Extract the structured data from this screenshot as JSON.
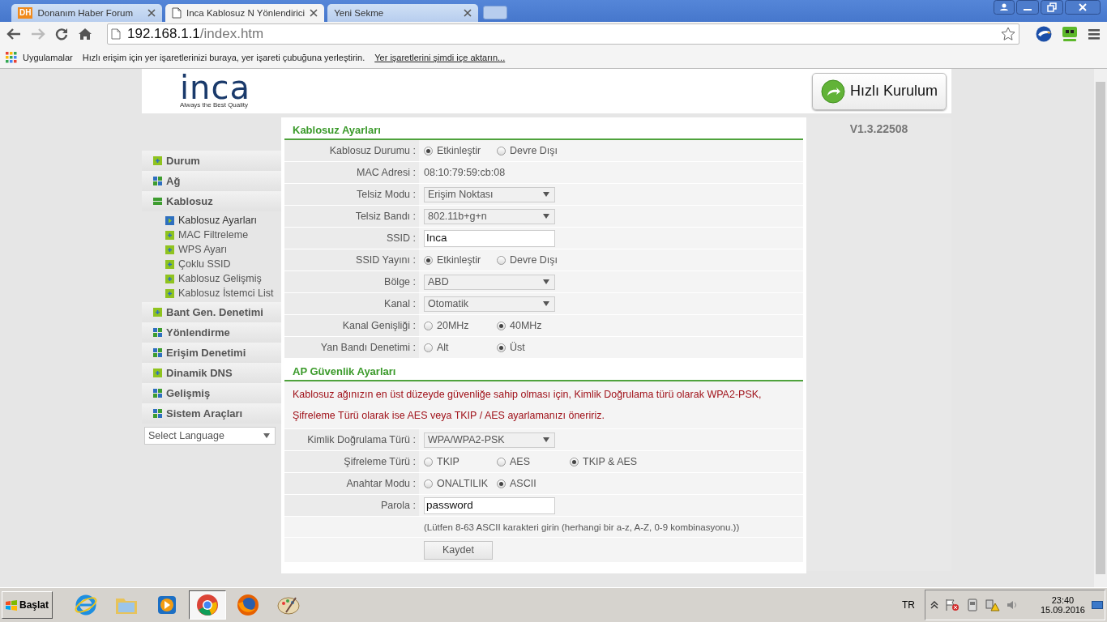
{
  "browser": {
    "tabs": [
      {
        "title": "Donanım Haber Forum",
        "selected": false,
        "kind": "badge",
        "badge": "DH"
      },
      {
        "title": "Inca Kablosuz N Yönlendirici",
        "selected": true,
        "kind": "page"
      },
      {
        "title": "Yeni Sekme",
        "selected": false,
        "kind": "blank"
      }
    ],
    "address": {
      "host": "192.168.1.1",
      "path": "/index.htm"
    },
    "bookmarks": {
      "apps_label": "Uygulamalar",
      "hint": "Hızlı erişim için yer işaretlerinizi buraya, yer işareti çubuğuna yerleştirin.",
      "import_link": "Yer işaretlerini şimdi içe aktarın..."
    }
  },
  "header": {
    "logo": "inca",
    "tagline": "Always the Best Quality",
    "quick_setup": "Hızlı Kurulum",
    "version": "V1.3.22508"
  },
  "sidebar": {
    "items": [
      {
        "label": "Durum",
        "kind": "page"
      },
      {
        "label": "Ağ",
        "kind": "group",
        "expanded": false
      },
      {
        "label": "Kablosuz",
        "kind": "group",
        "expanded": true,
        "children": [
          {
            "label": "Kablosuz Ayarları",
            "selected": true
          },
          {
            "label": "MAC Filtreleme",
            "selected": false
          },
          {
            "label": "WPS Ayarı",
            "selected": false
          },
          {
            "label": "Çoklu SSID",
            "selected": false
          },
          {
            "label": "Kablosuz Gelişmiş",
            "selected": false
          },
          {
            "label": "Kablosuz İstemci List",
            "selected": false
          }
        ]
      },
      {
        "label": "Bant Gen. Denetimi",
        "kind": "page"
      },
      {
        "label": "Yönlendirme",
        "kind": "group",
        "expanded": false
      },
      {
        "label": "Erişim Denetimi",
        "kind": "group",
        "expanded": false
      },
      {
        "label": "Dinamik DNS",
        "kind": "page"
      },
      {
        "label": "Gelişmiş",
        "kind": "group",
        "expanded": false
      },
      {
        "label": "Sistem Araçları",
        "kind": "group",
        "expanded": false
      }
    ],
    "language": "Select Language"
  },
  "sections": [
    {
      "title": "Kablosuz Ayarları",
      "rows": [
        {
          "kind": "radio",
          "label": "Kablosuz Durumu :",
          "options": [
            {
              "label": "Etkinleştir",
              "selected": true
            },
            {
              "label": "Devre Dışı",
              "selected": false
            }
          ]
        },
        {
          "kind": "text",
          "label": "MAC Adresi :",
          "value": "08:10:79:59:cb:08"
        },
        {
          "kind": "select",
          "label": "Telsiz Modu :",
          "value": "Erişim Noktası"
        },
        {
          "kind": "select",
          "label": "Telsiz Bandı :",
          "value": "802.11b+g+n"
        },
        {
          "kind": "input",
          "label": "SSID :",
          "value": "Inca"
        },
        {
          "kind": "radio",
          "label": "SSID Yayını :",
          "options": [
            {
              "label": "Etkinleştir",
              "selected": true
            },
            {
              "label": "Devre Dışı",
              "selected": false
            }
          ]
        },
        {
          "kind": "select",
          "label": "Bölge :",
          "value": "ABD"
        },
        {
          "kind": "select",
          "label": "Kanal :",
          "value": "Otomatik"
        },
        {
          "kind": "radio",
          "label": "Kanal Genişliği :",
          "options": [
            {
              "label": "20MHz",
              "selected": false
            },
            {
              "label": "40MHz",
              "selected": true
            }
          ]
        },
        {
          "kind": "radio",
          "label": "Yan Bandı Denetimi :",
          "options": [
            {
              "label": "Alt",
              "selected": false
            },
            {
              "label": "Üst",
              "selected": true
            }
          ]
        }
      ]
    },
    {
      "title": "AP Güvenlik Ayarları",
      "rows": [
        {
          "kind": "note",
          "text": "Kablosuz ağınızın en üst düzeyde güvenliğe sahip olması için, Kimlik Doğrulama türü olarak WPA2-PSK, Şifreleme Türü olarak ise AES veya TKIP / AES ayarlamanızı öneririz."
        },
        {
          "kind": "select",
          "label": "Kimlik Doğrulama Türü :",
          "value": "WPA/WPA2-PSK"
        },
        {
          "kind": "radio",
          "label": "Şifreleme Türü :",
          "options": [
            {
              "label": "TKIP",
              "selected": false
            },
            {
              "label": "AES",
              "selected": false
            },
            {
              "label": "TKIP & AES",
              "selected": true
            }
          ]
        },
        {
          "kind": "radio",
          "label": "Anahtar Modu :",
          "options": [
            {
              "label": "ONALTILIK",
              "selected": false
            },
            {
              "label": "ASCII",
              "selected": true
            }
          ]
        },
        {
          "kind": "input",
          "label": "Parola :",
          "value": "password"
        },
        {
          "kind": "hint",
          "text": "(Lütfen 8-63 ASCII karakteri girin (herhangi bir a-z, A-Z, 0-9 kombinasyonu.))"
        },
        {
          "kind": "button",
          "text": "Kaydet"
        }
      ]
    }
  ],
  "taskbar": {
    "start": "Başlat",
    "apps": [
      {
        "kind": "ie",
        "selected": false
      },
      {
        "kind": "folder",
        "selected": false
      },
      {
        "kind": "media",
        "selected": false
      },
      {
        "kind": "chrome",
        "selected": true
      },
      {
        "kind": "firefox",
        "selected": false
      },
      {
        "kind": "paint",
        "selected": false
      }
    ],
    "language": "TR",
    "time": "23:40",
    "date": "15.09.2016"
  }
}
